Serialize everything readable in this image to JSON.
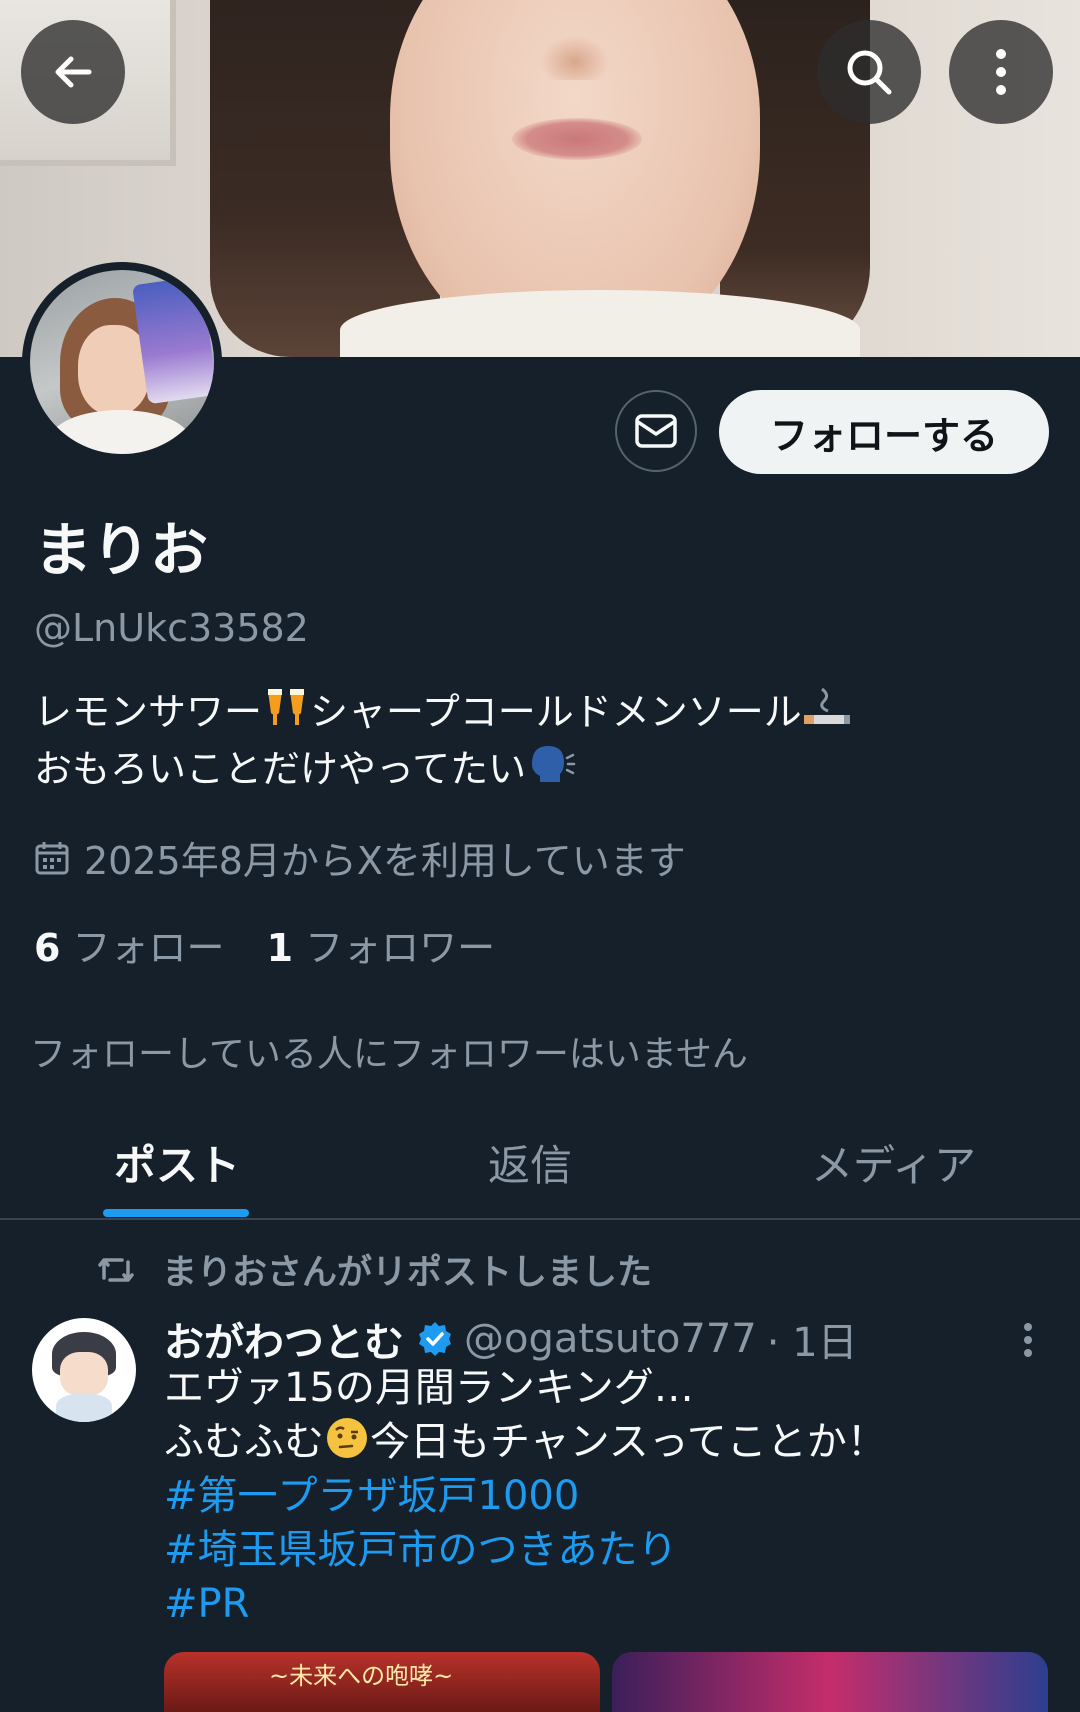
{
  "header": {
    "back_icon": "arrow-left-icon",
    "search_icon": "search-icon",
    "more_icon": "more-vertical-icon"
  },
  "profile": {
    "name": "まりお",
    "handle": "@LnUkc33582",
    "bio_line1_a": "レモンサワー",
    "bio_line1_b": "シャープコールドメンソール",
    "bio_line2": "おもろいことだけやってたい",
    "joined": "2025年8月からXを利用しています",
    "following_count": "6",
    "following_label": "フォロー",
    "followers_count": "1",
    "followers_label": "フォロワー",
    "mutual_note": "フォローしている人にフォロワーはいません"
  },
  "actions": {
    "message_icon": "mail-icon",
    "follow_label": "フォローする"
  },
  "tabs": [
    {
      "label": "ポスト",
      "active": true
    },
    {
      "label": "返信",
      "active": false
    },
    {
      "label": "メディア",
      "active": false
    }
  ],
  "feed": {
    "repost_label": "まりおさんがリポストしました",
    "post": {
      "author_name": "おがわつとむ",
      "author_handle": "@ogatsuto777",
      "time": "· 1日",
      "line1": "エヴァ15の月間ランキング…",
      "line2_a": "ふむふむ",
      "line2_b": "今日もチャンスってことか！",
      "tag1": "#第一プラザ坂戸1000",
      "tag2": "#埼玉県坂戸市のつきあたり",
      "tag3": "#PR",
      "media_caption": "~未来への咆哮~"
    }
  },
  "colors": {
    "background": "#15202b",
    "accent": "#1d9bf0",
    "secondary_text": "#8b98a5"
  }
}
